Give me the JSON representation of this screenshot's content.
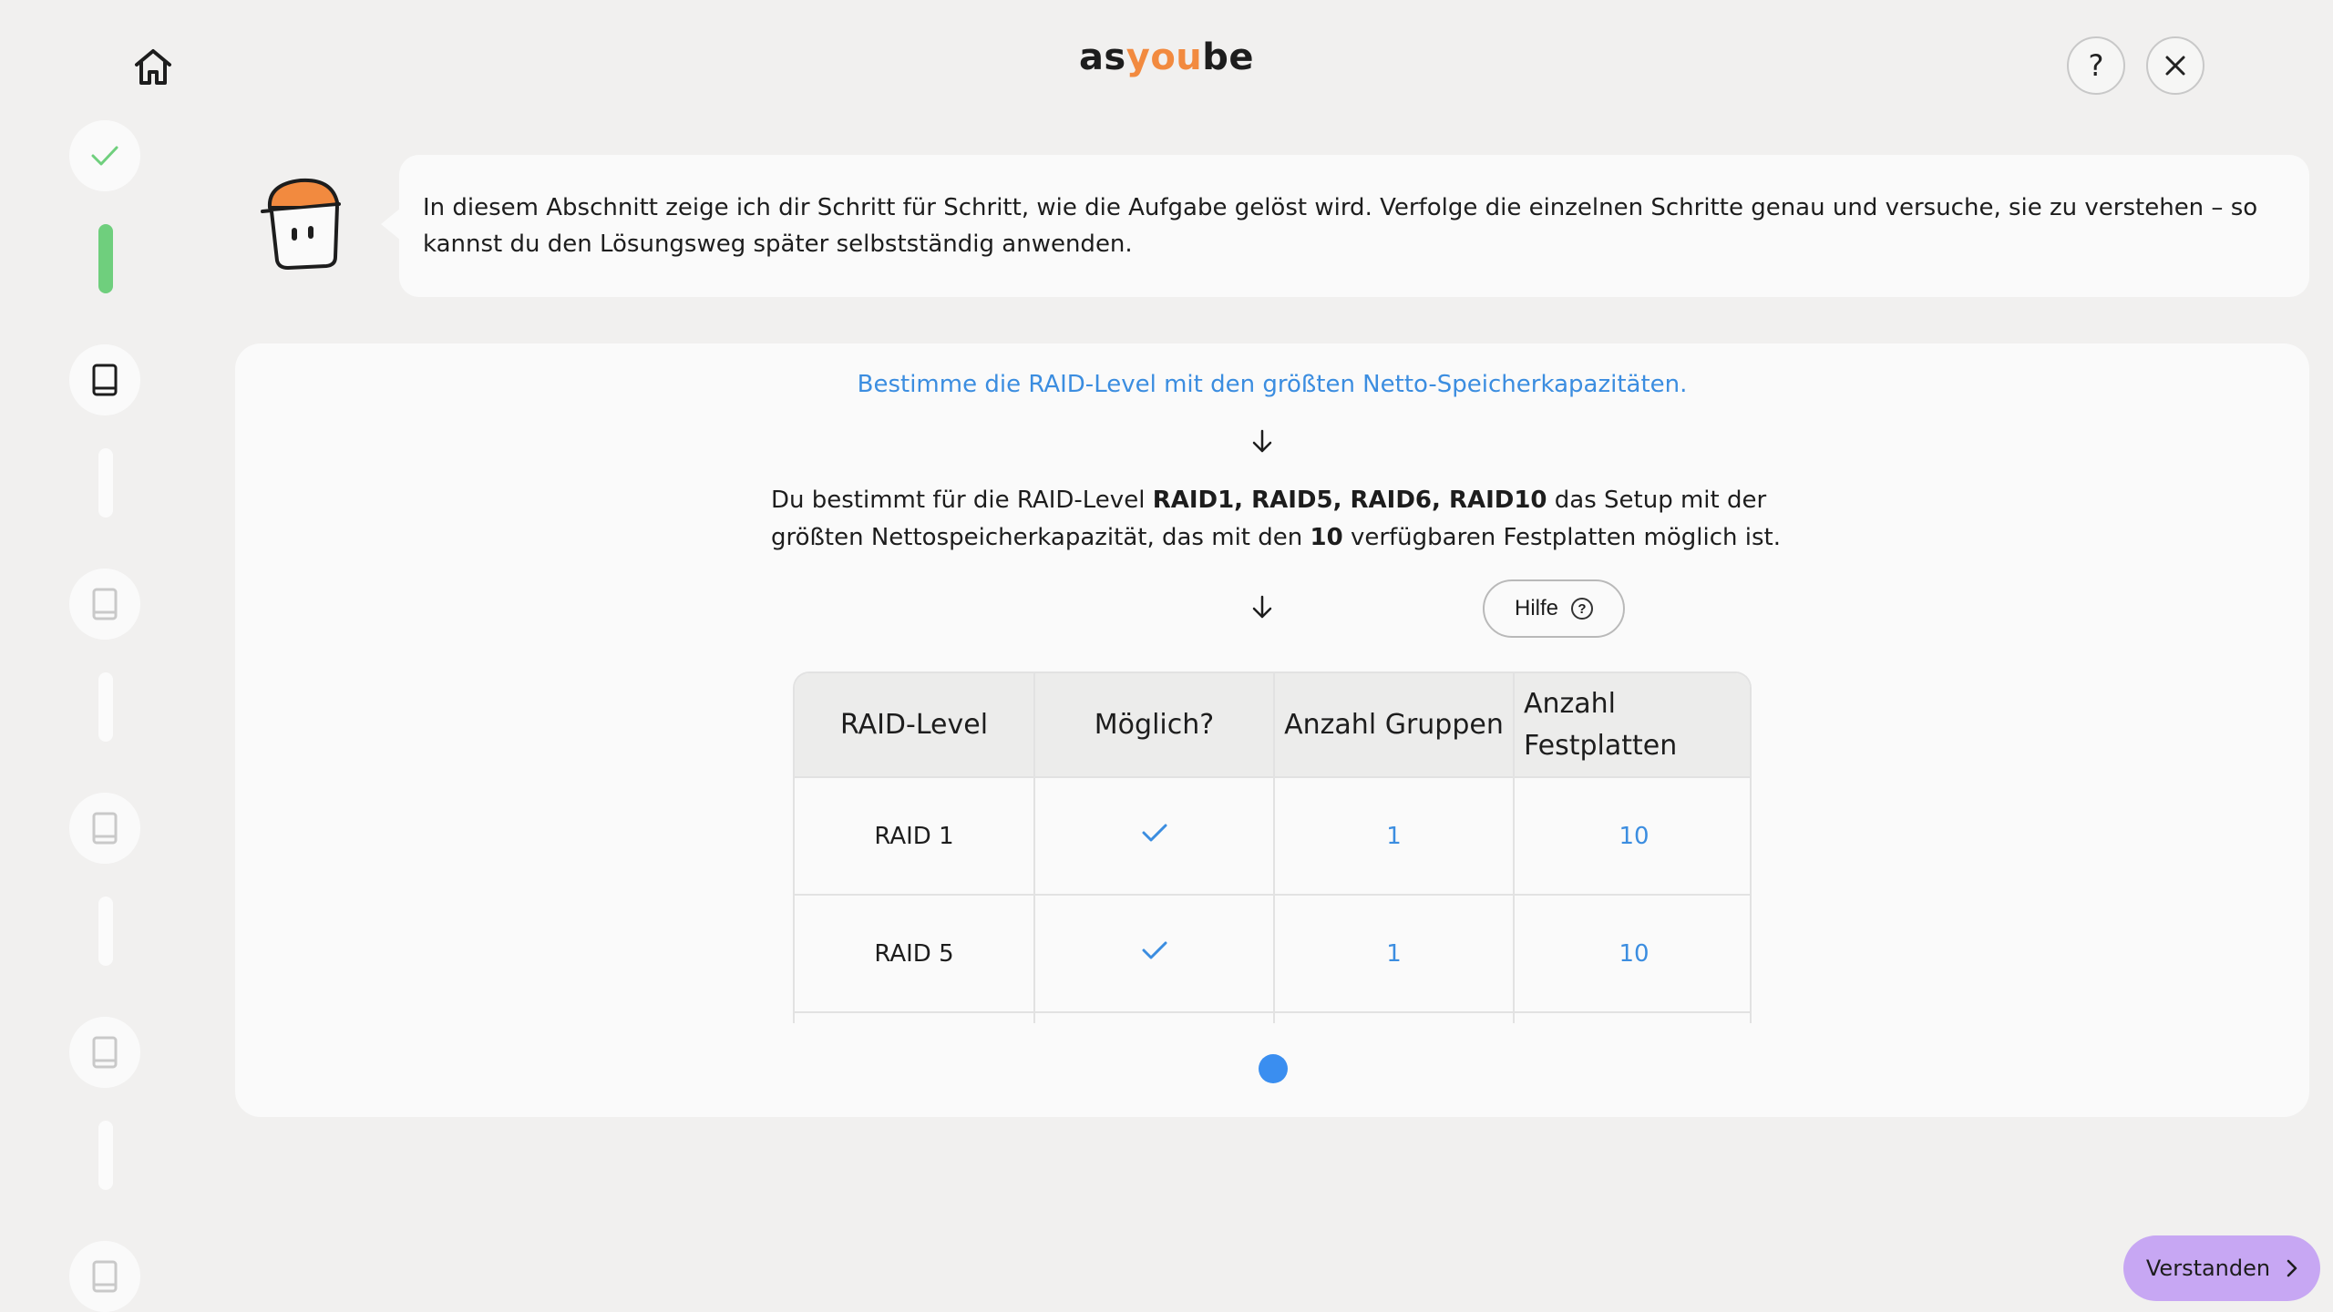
{
  "brand": {
    "logo_part1": "as",
    "logo_part2": "you",
    "logo_part3": "be"
  },
  "header": {
    "help_label": "?"
  },
  "bubble": {
    "text": "In diesem Abschnitt zeige ich dir Schritt für Schritt, wie die Aufgabe gelöst wird. Verfolge die einzelnen Schritte genau und versuche, sie zu verstehen – so kannst du den Lösungsweg später selbstständig anwenden."
  },
  "task": {
    "title": "Bestimme die RAID-Level mit den größten Netto-Speicherkapazitäten.",
    "desc_1": "Du bestimmt für die RAID-Level ",
    "desc_bold_levels": "RAID1, RAID5, RAID6, RAID10",
    "desc_2": " das Setup mit der größten Nettospeicherkapazität, das mit den ",
    "desc_bold_count": "10",
    "desc_3": " verfügbaren Festplatten möglich ist.",
    "help_button": "Hilfe",
    "help_icon": "?"
  },
  "table": {
    "headers": [
      "RAID-Level",
      "Möglich?",
      "Anzahl Gruppen",
      "Anzahl Festplatten"
    ],
    "rows": [
      {
        "level": "RAID 1",
        "possible": "check",
        "groups": "1",
        "disks": "10"
      },
      {
        "level": "RAID 5",
        "possible": "check",
        "groups": "1",
        "disks": "10"
      }
    ]
  },
  "footer": {
    "confirm_label": "Verstanden"
  },
  "colors": {
    "accent_blue": "#3b8de0",
    "brand_orange": "#f28a3f",
    "progress_green": "#6fcf7d",
    "confirm_purple": "#c7a7f3"
  },
  "icons": {
    "home": "home-icon",
    "close": "close-icon",
    "book": "book-icon",
    "check": "check-icon",
    "arrow": "arrow-down-icon",
    "chevron": "chevron-right-icon"
  }
}
